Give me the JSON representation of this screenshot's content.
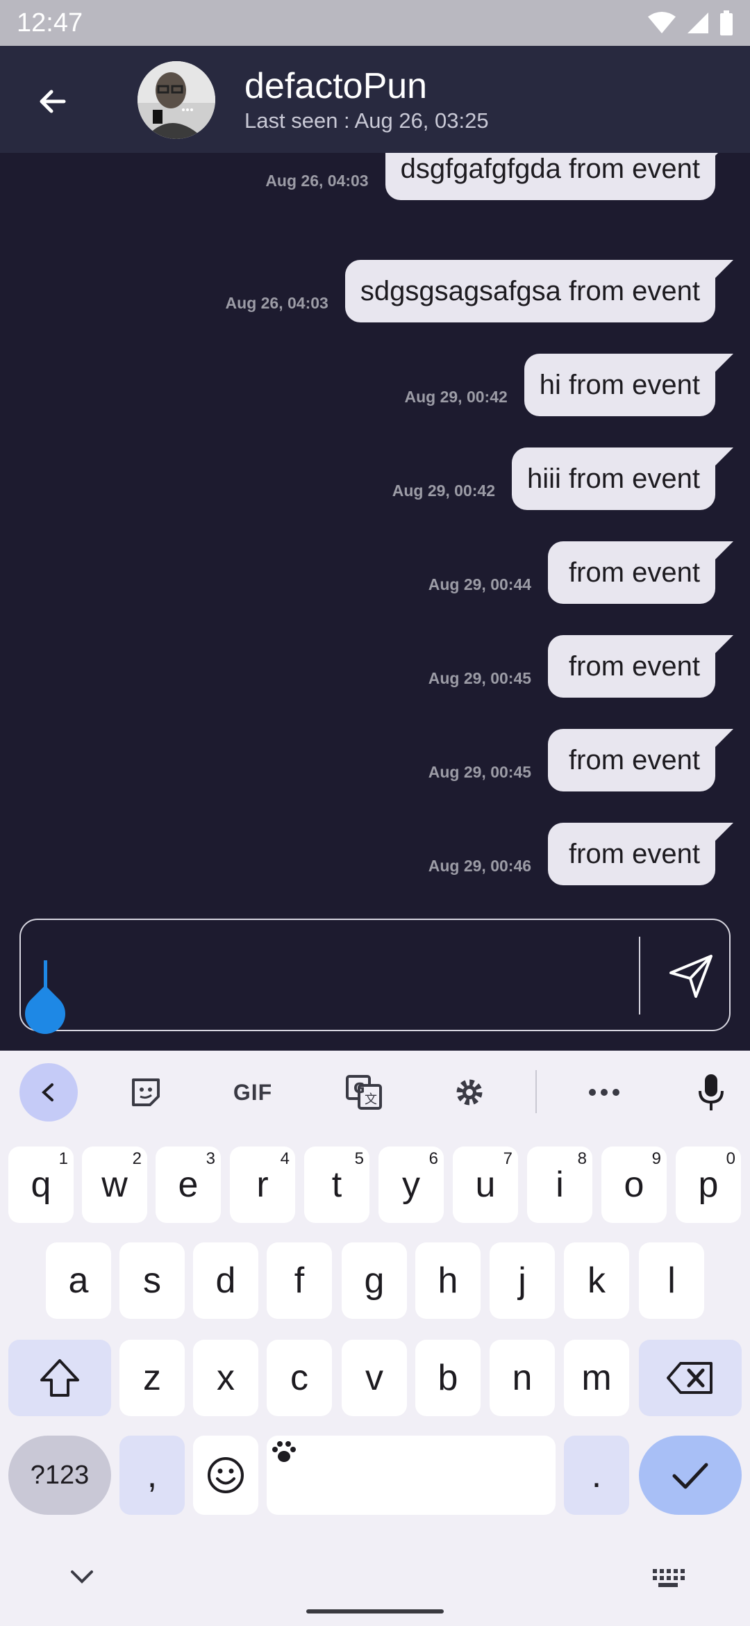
{
  "status_bar": {
    "time": "12:47"
  },
  "header": {
    "contact_name": "defactoPun",
    "last_seen": "Last seen : Aug 26, 03:25"
  },
  "messages": [
    {
      "time": "Aug 26, 04:03",
      "text": "dsgfgafgfgda from event"
    },
    {
      "time": "Aug 26, 04:03",
      "text": "sdgsgsagsafgsa from event"
    },
    {
      "time": "Aug 29, 00:42",
      "text": "hi from event"
    },
    {
      "time": "Aug 29, 00:42",
      "text": "hiii from event"
    },
    {
      "time": "Aug 29, 00:44",
      "text": "from event"
    },
    {
      "time": "Aug 29, 00:45",
      "text": "from event"
    },
    {
      "time": "Aug 29, 00:45",
      "text": "from event"
    },
    {
      "time": "Aug 29, 00:46",
      "text": "from event"
    }
  ],
  "input": {
    "value": "",
    "placeholder": ""
  },
  "keyboard": {
    "toolbar": {
      "gif_label": "GIF"
    },
    "row1": [
      {
        "key": "q",
        "hint": "1"
      },
      {
        "key": "w",
        "hint": "2"
      },
      {
        "key": "e",
        "hint": "3"
      },
      {
        "key": "r",
        "hint": "4"
      },
      {
        "key": "t",
        "hint": "5"
      },
      {
        "key": "y",
        "hint": "6"
      },
      {
        "key": "u",
        "hint": "7"
      },
      {
        "key": "i",
        "hint": "8"
      },
      {
        "key": "o",
        "hint": "9"
      },
      {
        "key": "p",
        "hint": "0"
      }
    ],
    "row2": [
      "a",
      "s",
      "d",
      "f",
      "g",
      "h",
      "j",
      "k",
      "l"
    ],
    "row3": [
      "z",
      "x",
      "c",
      "v",
      "b",
      "n",
      "m"
    ],
    "symbols_label": "?123",
    "comma_label": ",",
    "period_label": "."
  },
  "colors": {
    "background": "#1d1b2f",
    "app_bar": "#28293f",
    "bubble": "#e8e6ef",
    "accent": "#1e88e5"
  }
}
